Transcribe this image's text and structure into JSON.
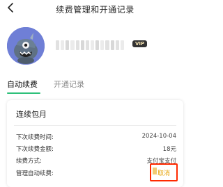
{
  "header": {
    "title": "续费管理和开通记录"
  },
  "profile": {
    "vip_badge": "VIP"
  },
  "tabs": [
    {
      "label": "自动续费",
      "active": true
    },
    {
      "label": "开通记录",
      "active": false
    }
  ],
  "subscription": {
    "plan_name": "连续包月",
    "rows": [
      {
        "label": "下次续费时间:",
        "value": "2024-10-04"
      },
      {
        "label": "下次续费金额:",
        "value": "18元"
      },
      {
        "label": "续费方式:",
        "value": "支付宝支付"
      },
      {
        "label": "管理自动续费:",
        "value": "取消"
      }
    ]
  },
  "colors": {
    "accent": "#2ec07a",
    "cancel_text": "#e6a100",
    "highlight_box": "#ff2a00",
    "avatar_bg": "#6f7fd6",
    "vip_bg": "#333333"
  },
  "icons": {
    "back": "chevron-left-icon",
    "avatar": "monster-avatar"
  }
}
